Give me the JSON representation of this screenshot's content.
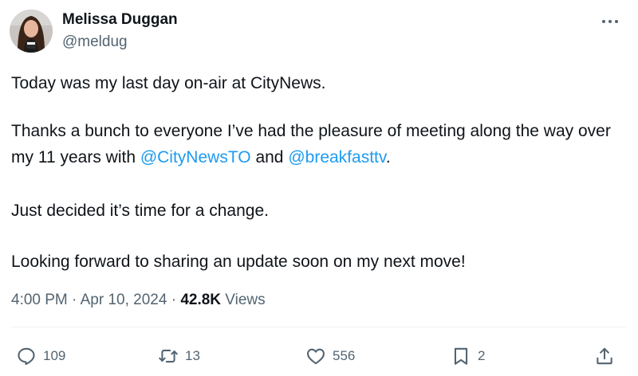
{
  "author": {
    "name": "Melissa Duggan",
    "handle": "@meldug"
  },
  "tweet": {
    "line1": "Today was my last day on-air at CityNews.",
    "p2_part1": "Thanks a bunch to everyone I’ve had the pleasure of meeting along the way over my 11 years with ",
    "mention1": "@CityNewsTO",
    "p2_and": " and ",
    "mention2": "@breakfasttv",
    "p2_end": ".",
    "line3": "Just decided it’s time for a change.",
    "line4": "Looking forward to sharing an update soon on my next move!"
  },
  "meta": {
    "time": "4:00 PM",
    "sep1": " · ",
    "date": "Apr 10, 2024",
    "sep2": " · ",
    "views_count": "42.8K",
    "views_label": " Views"
  },
  "actions": {
    "replies": "109",
    "reposts": "13",
    "likes": "556",
    "bookmarks": "2"
  },
  "icons": {
    "more": "more-dots-icon",
    "reply": "reply-bubble-icon",
    "repost": "repost-arrows-icon",
    "like": "heart-icon",
    "bookmark": "bookmark-icon",
    "share": "share-upload-icon"
  },
  "colors": {
    "text": "#0f1419",
    "secondary": "#536471",
    "link": "#1d9bf0"
  }
}
